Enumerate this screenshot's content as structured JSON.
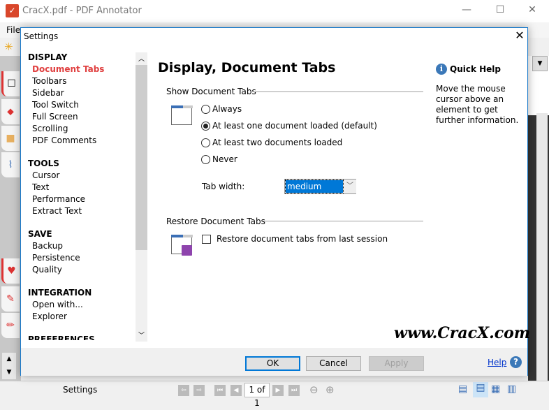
{
  "app": {
    "title": "CracX.pdf - PDF Annotator",
    "menu_file": "File",
    "minimize": "—",
    "maximize": "☐",
    "close": "✕"
  },
  "status": {
    "label": "Settings",
    "page": "1 of 1"
  },
  "dialog": {
    "title": "Settings",
    "close": "✕",
    "nav": [
      {
        "heading": "DISPLAY",
        "items": [
          "Document Tabs",
          "Toolbars",
          "Sidebar",
          "Tool Switch",
          "Full Screen",
          "Scrolling",
          "PDF Comments"
        ]
      },
      {
        "heading": "TOOLS",
        "items": [
          "Cursor",
          "Text",
          "Performance",
          "Extract Text"
        ]
      },
      {
        "heading": "SAVE",
        "items": [
          "Backup",
          "Persistence",
          "Quality"
        ]
      },
      {
        "heading": "INTEGRATION",
        "items": [
          "Open with...",
          "Explorer"
        ]
      },
      {
        "heading": "PREFERENCES",
        "items": []
      }
    ],
    "selected_nav": "Document Tabs",
    "page_title": "Display, Document Tabs",
    "show_tabs": {
      "label": "Show Document Tabs",
      "options": [
        "Always",
        "At least one document loaded (default)",
        "At least two documents loaded",
        "Never"
      ],
      "selected": 1,
      "tab_width_label": "Tab width:",
      "tab_width_value": "medium"
    },
    "restore": {
      "label": "Restore Document Tabs",
      "checkbox": "Restore document tabs from last session",
      "checked": false
    },
    "quick_help": {
      "title": "Quick Help",
      "text": "Move the mouse cursor above an element to get further information."
    },
    "watermark": "www.CracX.com",
    "buttons": {
      "ok": "OK",
      "cancel": "Cancel",
      "apply": "Apply",
      "help": "Help"
    }
  },
  "colors": {
    "accent": "#0078d7",
    "selected_nav": "#e04040",
    "info": "#3b78b8"
  }
}
